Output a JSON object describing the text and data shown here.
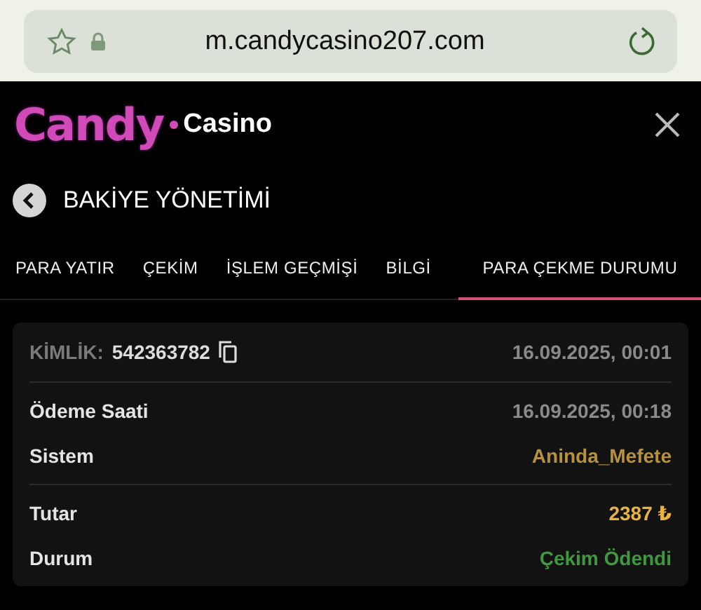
{
  "browser": {
    "url": "m.candycasino207.com"
  },
  "logo": {
    "brand": "Candy",
    "suffix": "Casino"
  },
  "section": {
    "title": "BAKİYE YÖNETİMİ"
  },
  "tabs": [
    {
      "label": "PARA YATIR",
      "selected": false
    },
    {
      "label": "ÇEKİM",
      "selected": false
    },
    {
      "label": "İŞLEM GEÇMİŞİ",
      "selected": false
    },
    {
      "label": "BİLGİ",
      "selected": false
    },
    {
      "label": "PARA ÇEKME DURUMU",
      "selected": true
    }
  ],
  "card": {
    "id_label": "KİMLİK:",
    "id_value": "542363782",
    "created": "16.09.2025, 00:01",
    "groups": [
      [
        {
          "label": "Ödeme Saati",
          "value": "16.09.2025, 00:18",
          "color": "#8a8a8a"
        },
        {
          "label": "Sistem",
          "value": "Aninda_Mefete",
          "color": "#b8913a"
        }
      ],
      [
        {
          "label": "Tutar",
          "value": "2387 ₺",
          "color": "#e8b342"
        },
        {
          "label": "Durum",
          "value": "Çekim Ödendi",
          "color": "#3e9a3e"
        }
      ]
    ]
  }
}
